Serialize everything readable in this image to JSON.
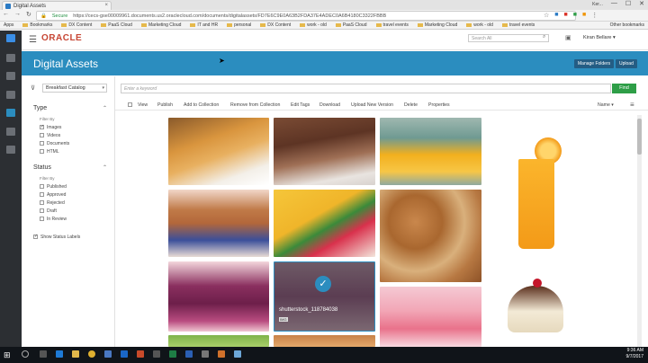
{
  "browser": {
    "tab_title": "Digital Assets",
    "tab_close": "×",
    "window_controls": [
      "—",
      "☐",
      "✕"
    ],
    "user_badge": "Ker...",
    "security_label": "Secure",
    "url": "https://cecs-gse00009961.documents.us2.oraclecloud.com/documents/digitalassets/FD7E6C9E0A63B2FDA37E4ADEC0A6B4180C3322FBBB",
    "bookmarks": [
      "Apps",
      "Bookmarks",
      "DX Content",
      "PaaS Cloud",
      "Marketing Cloud",
      "IT and HR",
      "personal",
      "DX Content",
      "work - old",
      "PaaS Cloud",
      "travel events",
      "Marketing Cloud",
      "work - old",
      "travel events"
    ],
    "other_bookmarks": "Other bookmarks"
  },
  "header": {
    "logo": "ORACLE",
    "search_placeholder": "Search All",
    "user_name": "Kiran Bellare",
    "user_caret": "▾"
  },
  "banner": {
    "title": "Digital Assets",
    "manage_folders": "Manage Folders",
    "upload": "Upload"
  },
  "filters": {
    "catalog": "Breakfast Catalog",
    "type_title": "Type",
    "type_filter_by": "Filter By",
    "type_options": [
      {
        "label": "Images",
        "checked": true
      },
      {
        "label": "Videos",
        "checked": false
      },
      {
        "label": "Documents",
        "checked": false
      },
      {
        "label": "HTML",
        "checked": false
      }
    ],
    "status_title": "Status",
    "status_filter_by": "Filter By",
    "status_options": [
      {
        "label": "Published",
        "checked": false
      },
      {
        "label": "Approved",
        "checked": false
      },
      {
        "label": "Rejected",
        "checked": false
      },
      {
        "label": "Draft",
        "checked": false
      },
      {
        "label": "In Review",
        "checked": false
      }
    ],
    "show_status_labels": "Show Status Labels"
  },
  "search": {
    "placeholder": "Enter a keyword",
    "find": "Find"
  },
  "toolbar": {
    "actions": [
      "View",
      "Publish",
      "Add to Collection",
      "Remove from Collection",
      "Edit Tags",
      "Download",
      "Upload New Version",
      "Delete",
      "Properties"
    ],
    "sort": "Name"
  },
  "selected_asset": {
    "name": "shutterstock_118784038",
    "type_badge": "IMG"
  },
  "taskbar": {
    "time": "9:36 AM",
    "date": "9/7/2017"
  },
  "colors": {
    "accent": "#2b8dbf",
    "oracle_red": "#c74634",
    "find_green": "#2e9e47",
    "rail": "#2c2f33"
  }
}
